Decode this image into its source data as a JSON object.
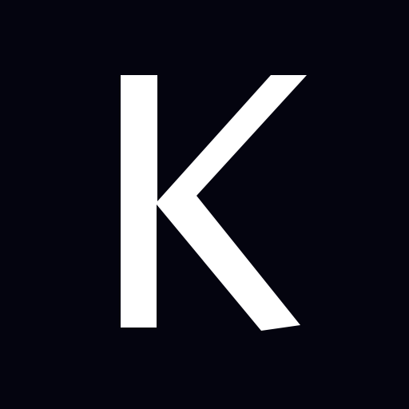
{
  "logo": {
    "letter": "K",
    "background_color": "#04040f",
    "letter_color": "#ffffff"
  }
}
